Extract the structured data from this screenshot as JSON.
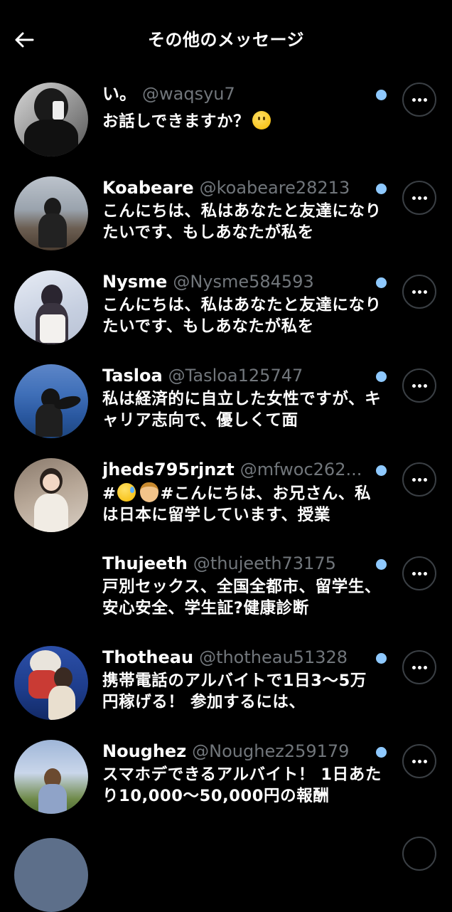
{
  "header": {
    "title": "その他のメッセージ",
    "back_icon": "arrow-left-icon"
  },
  "colors": {
    "background": "#000000",
    "unread_dot": "#8ec9ff",
    "handle": "#71767b"
  },
  "messages": [
    {
      "name": "い。",
      "handle": "@waqsyu7",
      "preview": "お話しできますか？",
      "emoji": "slightly-smiling-face",
      "unread": true
    },
    {
      "name": "Koabeare",
      "handle": "@koabeare28213",
      "preview": "こんにちは、私はあなたと友達になりたいです、もしあなたが私を",
      "unread": true
    },
    {
      "name": "Nysme",
      "handle": "@Nysme584593",
      "preview": "こんにちは、私はあなたと友達になりたいです、もしあなたが私を",
      "unread": true
    },
    {
      "name": "Tasloa",
      "handle": "@Tasloa125747",
      "preview": "私は経済的に自立した女性ですが、キャリア志向で、優しくて面",
      "unread": true
    },
    {
      "name": "jheds795rjnzt",
      "handle": "@mfwoc262...",
      "preview_prefix": "#",
      "preview": "#こんにちは、お兄さん、私は日本に留学しています、授業",
      "unread": true
    },
    {
      "name": "Thujeeth",
      "handle": "@thujeeth73175",
      "preview": "戸別セックス、全国全都市、留学生、安心安全、学生証?健康診断",
      "unread": true
    },
    {
      "name": "Thotheau",
      "handle": "@thotheau51328",
      "preview": "携帯電話のアルバイトで1日3〜5万円稼げる！ 参加するには、",
      "unread": true
    },
    {
      "name": "Noughez",
      "handle": "@Noughez259179",
      "preview": "スマホデできるアルバイト！ 1日あたり10,000〜50,000円の報酬",
      "unread": true
    }
  ]
}
